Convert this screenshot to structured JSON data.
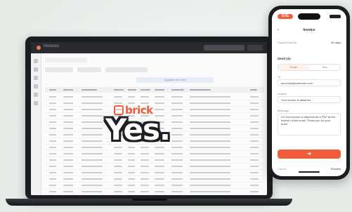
{
  "overlay": {
    "brand": "brick",
    "headline": "Yes."
  },
  "laptop": {
    "app_title": "Invoices",
    "topbar_primary": "Create invoice",
    "banner": "Upgrade for more"
  },
  "phone": {
    "time": "9:41",
    "back": "‹",
    "title": "Invoice",
    "payment_label": "Payment terms",
    "payment_value": "30 days",
    "send_via": "Send via",
    "option_email": "Email",
    "option_sms": "Text",
    "to_label": "To",
    "to_value": "accounts@customer.com",
    "subject_label": "Subject",
    "subject_value": "Your invoice is attached",
    "message_label": "Message",
    "message_value": "Hi! Your invoice is attached as a PDF at the bottom of this email. Thank you for your trust!",
    "send_button": "➜",
    "footer_left": "Cancel",
    "footer_right": "Preview"
  },
  "colors": {
    "accent": "#f05d3b",
    "dark": "#1e1f22"
  }
}
